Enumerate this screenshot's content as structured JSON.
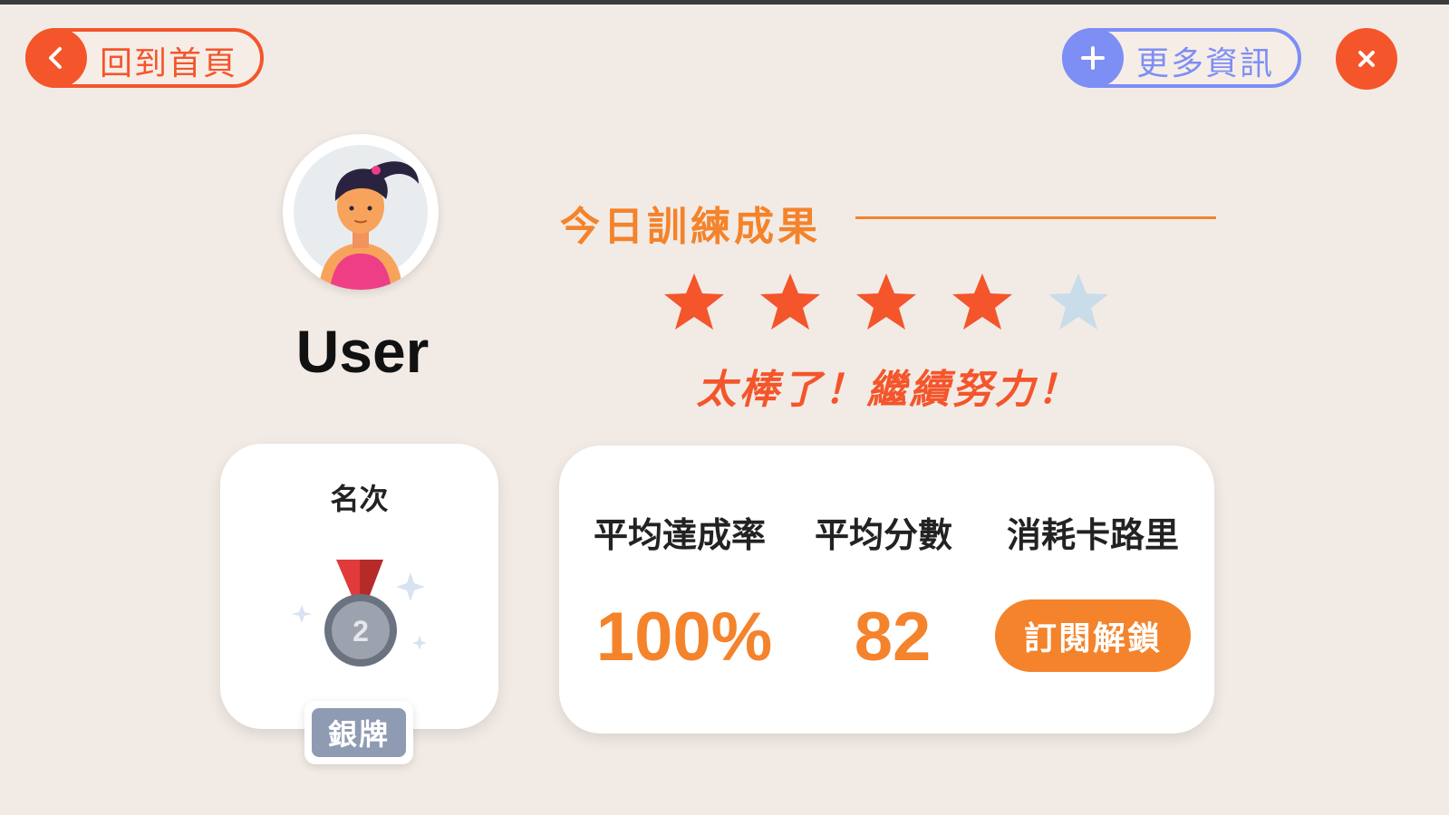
{
  "header": {
    "home_label": "回到首頁",
    "more_info_label": "更多資訊"
  },
  "user": {
    "name": "User"
  },
  "results": {
    "title": "今日訓練成果",
    "rating": 4,
    "max_rating": 5,
    "praise": "太棒了！繼續努力！"
  },
  "rank": {
    "label": "名次",
    "medal_number": "2",
    "medal_name": "銀牌"
  },
  "stats": {
    "completion_label": "平均達成率",
    "completion_value": "100%",
    "score_label": "平均分數",
    "score_value": "82",
    "calories_label": "消耗卡路里",
    "calories_action": "訂閱解鎖"
  },
  "colors": {
    "accent_red": "#f4552b",
    "accent_orange": "#f4832b",
    "accent_blue": "#7d8ef5",
    "star_empty": "#c9dcea",
    "badge_silver": "#8f9bb3",
    "background": "#f2ebe5"
  },
  "icons": {
    "home_button": "chevron-left-icon",
    "more_info_button": "plus-icon",
    "close_button": "close-icon",
    "rank_medal": "silver-medal-icon"
  }
}
